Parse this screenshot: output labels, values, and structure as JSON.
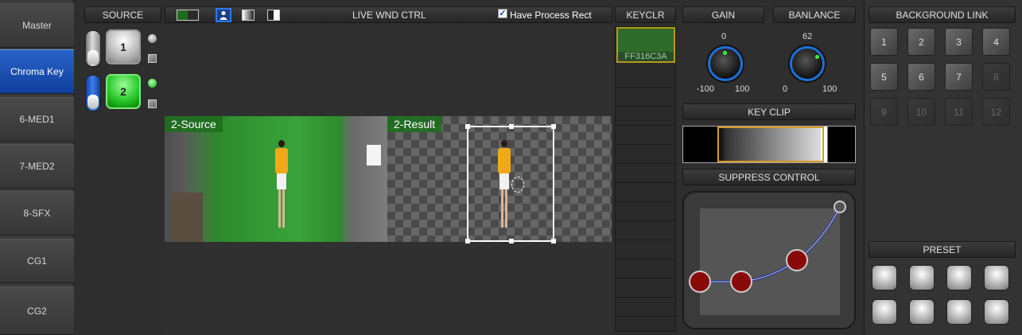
{
  "nav": {
    "items": [
      {
        "label": "Master"
      },
      {
        "label": "Chroma Key"
      },
      {
        "label": "6-MED1"
      },
      {
        "label": "7-MED2"
      },
      {
        "label": "8-SFX"
      },
      {
        "label": "CG1"
      },
      {
        "label": "CG2"
      }
    ],
    "active_index": 1
  },
  "source": {
    "title": "SOURCE",
    "buttons": [
      "1",
      "2"
    ]
  },
  "live": {
    "title": "LIVE WND CTRL",
    "checkbox_label": "Have Process Rect",
    "checkbox_checked": true,
    "checkbox_mark": "✓"
  },
  "preview": {
    "source_label": "2-Source",
    "result_label": "2-Result"
  },
  "keyclr": {
    "title": "KEYCLR",
    "swatch_color": "#2f6b2a",
    "value": "FF316C3A"
  },
  "gain": {
    "title": "GAIN",
    "value": "0",
    "min": "-100",
    "max": "100"
  },
  "balance": {
    "title": "BANLANCE",
    "value": "62",
    "min": "0",
    "max": "100"
  },
  "key_clip": {
    "title": "KEY CLIP"
  },
  "suppress": {
    "title": "SUPPRESS CONTROL"
  },
  "background_link": {
    "title": "BACKGROUND LINK",
    "buttons": [
      "1",
      "2",
      "3",
      "4",
      "5",
      "6",
      "7",
      "8",
      "9",
      "10",
      "11",
      "12"
    ],
    "enabled_count": 7
  },
  "preset": {
    "title": "PRESET"
  },
  "colors": {
    "accent": "#1e6fd9",
    "active_nav": "#1a4fb5",
    "green": "#26c326",
    "curve": "#1c2fa0",
    "handle": "#8a0a0a"
  }
}
